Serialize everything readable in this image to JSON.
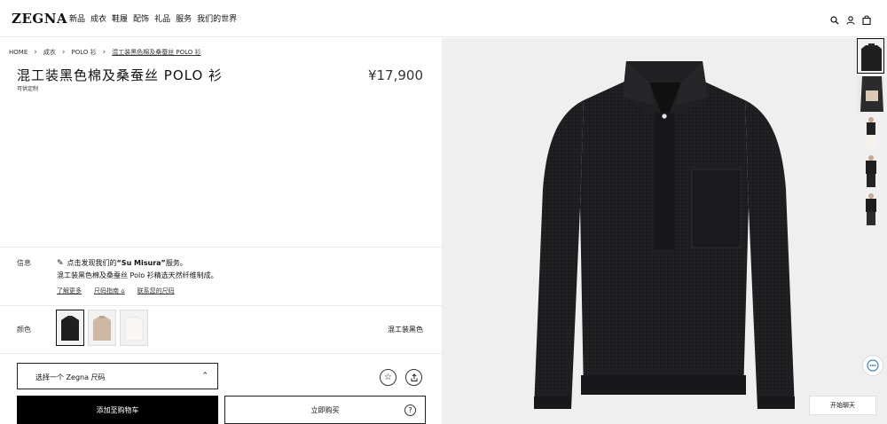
{
  "header": {
    "logo": "ZEGNA",
    "nav": [
      "新品",
      "成衣",
      "鞋履",
      "配饰",
      "礼品",
      "服务",
      "我们的世界"
    ],
    "icons": [
      "search-icon",
      "account-icon",
      "bag-icon"
    ]
  },
  "breadcrumb": [
    "HOME",
    "成衣",
    "POLO 衫",
    "混工装黑色棉及桑蚕丝 POLO 衫"
  ],
  "product": {
    "title": "混工装黑色棉及桑蚕丝 POLO 衫",
    "subtitle": "可供定制",
    "price": "¥17,900"
  },
  "info": {
    "label": "信息",
    "line1_prefix": "点击发现我们的",
    "line1_highlight": "“Su Misura”",
    "line1_suffix": "服务。",
    "line2": "混工装黑色棉及桑蚕丝 Polo 衫精选天然纤维制成。",
    "links": [
      "了解更多",
      "尺码指南 ⌂",
      "联系您的尺码"
    ]
  },
  "color": {
    "label": "颜色",
    "selected_name": "混工装黑色",
    "swatches": [
      {
        "name": "black",
        "color": "#1f1f1f"
      },
      {
        "name": "beige",
        "color": "#cdb9a3"
      },
      {
        "name": "white",
        "color": "#f3f1ec"
      }
    ]
  },
  "size": {
    "placeholder": "选择一个 Zegna 尺码"
  },
  "buttons": {
    "add_to_cart": "添加至购物车",
    "buy_now": "立即购买",
    "chat": "开始聊天"
  },
  "colors": {
    "accent": "#000000",
    "gallery_bg": "#efefef",
    "garment": "#1c1c1e"
  }
}
